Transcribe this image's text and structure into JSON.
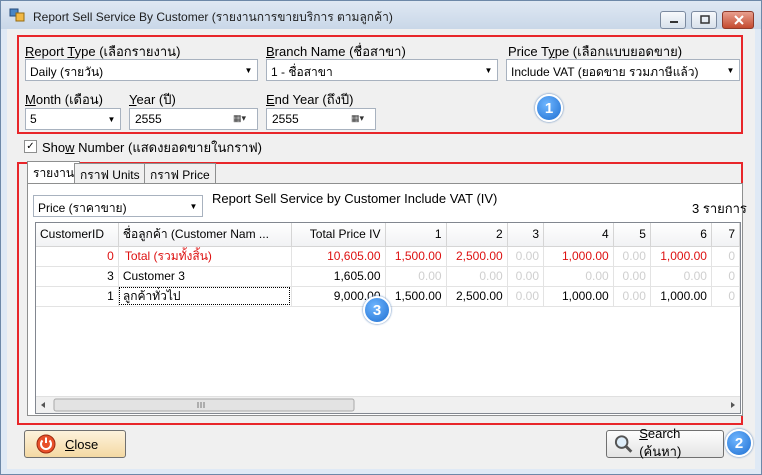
{
  "window": {
    "title": "Report Sell Service By Customer (รายงานการขายบริการ ตามลูกค้า)"
  },
  "filters": {
    "report_type_label_ul": "R",
    "report_type_label_a": "eport ",
    "report_type_label_ul2": "T",
    "report_type_label_b": "ype (เลือกรายงาน)",
    "report_type_value": "Daily (รายวัน)",
    "branch_label_ul": "B",
    "branch_label_rest": "ranch Name (ชื่อสาขา)",
    "branch_value": "1 - ชื่อสาขา",
    "price_type_label_a": "Price T",
    "price_type_label_ul": "y",
    "price_type_label_b": "pe (เลือกแบบยอดขาย)",
    "price_type_value": "Include VAT (ยอดขาย รวมภาษีแล้ว)",
    "month_label_ul": "M",
    "month_label_rest": "onth (เดือน)",
    "month_value": "5",
    "year_label_ul": "Y",
    "year_label_rest": "ear (ปี)",
    "year_value": "2555",
    "end_year_label_ul": "E",
    "end_year_label_rest": "nd Year (ถึงปี)",
    "end_year_value": "2555",
    "show_number_a": "Sho",
    "show_number_ul": "w",
    "show_number_b": " Number (แสดงยอดขายในกราฟ)",
    "show_number_checked": true
  },
  "tabs": [
    "รายงาน",
    "กราฟ Units",
    "กราฟ Price"
  ],
  "report": {
    "price_select": "Price (ราคาขาย)",
    "title": "Report Sell Service by Customer Include VAT (IV)",
    "count": "3 รายการ",
    "columns": [
      "CustomerID",
      "ชื่อลูกค้า  (Customer Nam ...",
      "Total Price IV",
      "1",
      "2",
      "3",
      "4",
      "5",
      "6",
      "7"
    ],
    "rows": [
      [
        "0",
        "Total  (รวมทั้งสิ้น)",
        "10,605.00",
        "1,500.00",
        "2,500.00",
        "0.00",
        "1,000.00",
        "0.00",
        "1,000.00",
        "0"
      ],
      [
        "3",
        "Customer 3",
        "1,605.00",
        "0.00",
        "0.00",
        "0.00",
        "0.00",
        "0.00",
        "0.00",
        "0"
      ],
      [
        "1",
        "ลูกค้าทั่วไป",
        "9,000.00",
        "1,500.00",
        "2,500.00",
        "0.00",
        "1,000.00",
        "0.00",
        "1,000.00",
        "0"
      ]
    ]
  },
  "buttons": {
    "close_ul": "C",
    "close_rest": "lose",
    "search_ul": "S",
    "search_rest": "earch (ค้นหา)"
  },
  "badges": [
    "1",
    "2",
    "3"
  ],
  "icons": [
    "app-icon",
    "calendar-icon",
    "power-icon",
    "magnifier-icon",
    "minimize-icon",
    "maximize-icon",
    "close-icon"
  ],
  "colors": {
    "highlight_border": "#e8262a",
    "total_row_text": "#d11111",
    "badge": "#1f6fd1"
  }
}
